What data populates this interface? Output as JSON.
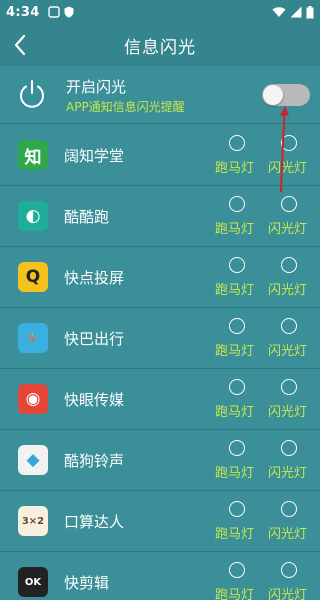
{
  "status_bar": {
    "time": "4:34"
  },
  "header": {
    "title": "信息闪光"
  },
  "flash_toggle": {
    "title": "开启闪光",
    "subtitle": "APP通知信息闪光提醒",
    "enabled": false
  },
  "options": {
    "marquee": "跑马灯",
    "flash": "闪光灯"
  },
  "apps": [
    {
      "name": "阔知学堂",
      "icon": "kuozhi-icon",
      "glyph": "知",
      "bg": "#2ea84a",
      "fg": "#ffffff"
    },
    {
      "name": "酷酷跑",
      "icon": "kukupao-icon",
      "glyph": "◐",
      "bg": "#1fae9a",
      "fg": "#ffffff"
    },
    {
      "name": "快点投屏",
      "icon": "kuaidian-icon",
      "glyph": "Q",
      "bg": "#f4c21b",
      "fg": "#222222"
    },
    {
      "name": "快巴出行",
      "icon": "kuaiba-icon",
      "glyph": "🦌",
      "bg": "#3ab0e0",
      "fg": "#ffffff"
    },
    {
      "name": "快眼传媒",
      "icon": "kuaiyan-icon",
      "glyph": "◉",
      "bg": "#e6453a",
      "fg": "#ffffff"
    },
    {
      "name": "酷狗铃声",
      "icon": "kugou-icon",
      "glyph": "◆",
      "bg": "#f2f2f2",
      "fg": "#3aa6d8"
    },
    {
      "name": "口算达人",
      "icon": "kousuan-icon",
      "glyph": "3×2",
      "bg": "#f7efe0",
      "fg": "#6b4a2a"
    },
    {
      "name": "快剪辑",
      "icon": "kuaijianji-icon",
      "glyph": "OK",
      "bg": "#222222",
      "fg": "#ffffff"
    }
  ],
  "colors": {
    "background": "#3a8f99",
    "bar": "#35858f",
    "accent_text": "#c7e84a",
    "arrow": "#d0202a"
  }
}
